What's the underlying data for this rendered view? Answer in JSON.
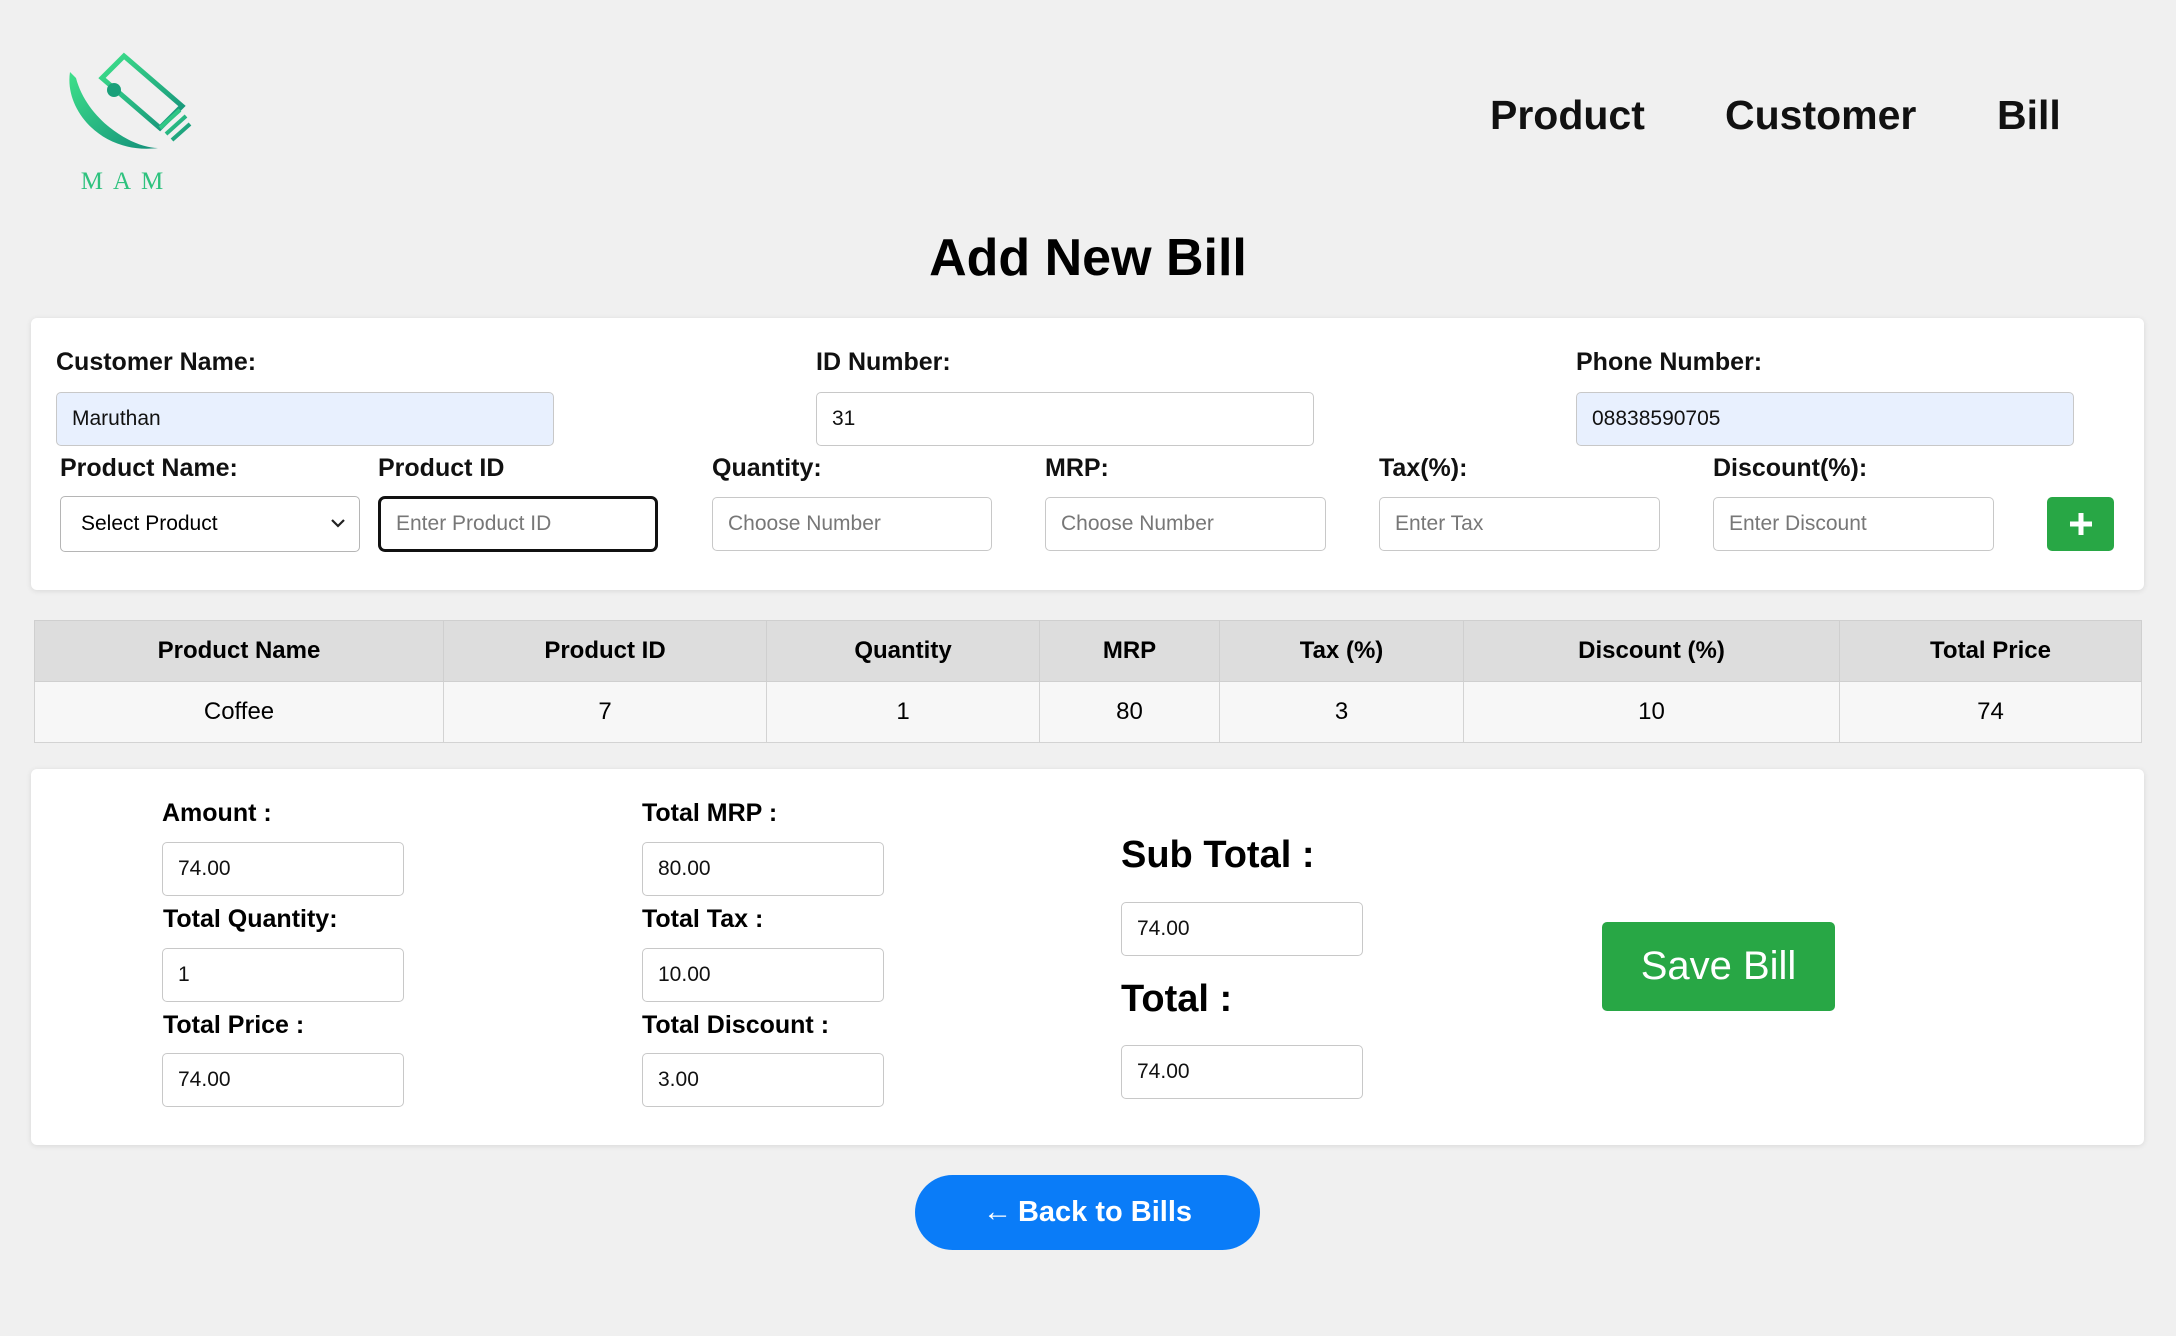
{
  "brand": {
    "logo_text": "MAM",
    "logo_icon": "money-bills-swoosh",
    "accent": "#2ec27e"
  },
  "nav": {
    "product": "Product",
    "customer": "Customer",
    "bill": "Bill"
  },
  "page": {
    "title": "Add New Bill"
  },
  "customer": {
    "name_label": "Customer Name:",
    "name_value": "Maruthan",
    "id_label": "ID Number:",
    "id_value": "31",
    "phone_label": "Phone Number:",
    "phone_value": "08838590705"
  },
  "item_form": {
    "product_name_label": "Product Name:",
    "product_select_value": "Select Product",
    "product_id_label": "Product ID",
    "product_id_placeholder": "Enter Product ID",
    "quantity_label": "Quantity:",
    "quantity_placeholder": "Choose Number",
    "mrp_label": "MRP:",
    "mrp_placeholder": "Choose Number",
    "tax_label": "Tax(%):",
    "tax_placeholder": "Enter Tax",
    "discount_label": "Discount(%):",
    "discount_placeholder": "Enter Discount",
    "add_icon": "plus-icon"
  },
  "table": {
    "headers": [
      "Product Name",
      "Product ID",
      "Quantity",
      "MRP",
      "Tax (%)",
      "Discount (%)",
      "Total Price"
    ],
    "rows": [
      [
        "Coffee",
        "7",
        "1",
        "80",
        "3",
        "10",
        "74"
      ]
    ]
  },
  "summary": {
    "amount_label": "Amount :",
    "amount_value": "74.00",
    "total_quantity_label": "Total Quantity:",
    "total_quantity_value": "1",
    "total_price_label": "Total Price :",
    "total_price_value": "74.00",
    "total_mrp_label": "Total MRP :",
    "total_mrp_value": "80.00",
    "total_tax_label": "Total Tax :",
    "total_tax_value": "10.00",
    "total_discount_label": "Total Discount :",
    "total_discount_value": "3.00",
    "sub_total_label": "Sub Total :",
    "sub_total_value": "74.00",
    "total_label": "Total :",
    "total_value": "74.00"
  },
  "actions": {
    "save_label": "Save Bill",
    "back_arrow": "←",
    "back_label": "Back to Bills"
  },
  "colors": {
    "save": "#28a745",
    "back": "#0a7cf8",
    "autofill": "#e8f0fe"
  }
}
